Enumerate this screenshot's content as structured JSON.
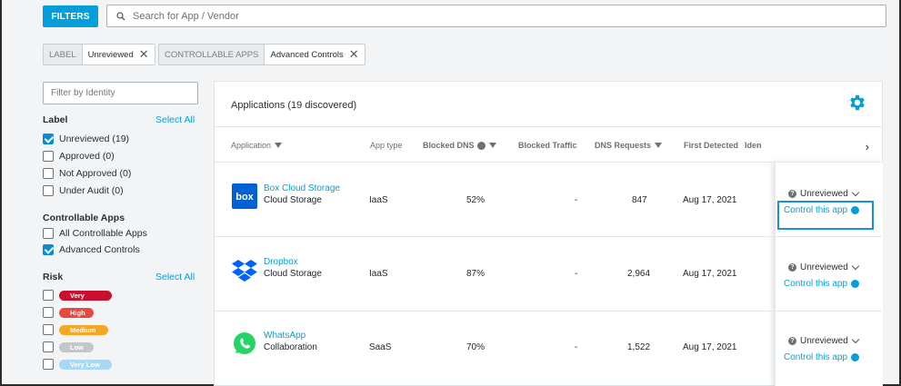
{
  "toolbar": {
    "filters_label": "FILTERS",
    "search_placeholder": "Search for App / Vendor"
  },
  "active_filters": [
    {
      "key": "LABEL",
      "value": "Unreviewed"
    },
    {
      "key": "CONTROLLABLE APPS",
      "value": "Advanced Controls"
    }
  ],
  "sidebar": {
    "identity_placeholder": "Filter by Identity",
    "label_section": {
      "title": "Label",
      "select_all": "Select All",
      "options": [
        {
          "label": "Unreviewed (19)",
          "checked": true
        },
        {
          "label": "Approved (0)",
          "checked": false
        },
        {
          "label": "Not Approved (0)",
          "checked": false
        },
        {
          "label": "Under Audit (0)",
          "checked": false
        }
      ]
    },
    "controllable_section": {
      "title": "Controllable Apps",
      "options": [
        {
          "label": "All Controllable Apps",
          "checked": false
        },
        {
          "label": "Advanced Controls",
          "checked": true
        }
      ]
    },
    "risk_section": {
      "title": "Risk",
      "select_all": "Select All",
      "options": [
        {
          "label": "Very High",
          "color": "#c8102e"
        },
        {
          "label": "High",
          "color": "#e8493f"
        },
        {
          "label": "Medium",
          "color": "#f5a623"
        },
        {
          "label": "Low",
          "color": "#c3c7ca"
        },
        {
          "label": "Very Low",
          "color": "#a9d8f5"
        }
      ]
    }
  },
  "main": {
    "title": "Applications (19 discovered)",
    "columns": {
      "application": "Application",
      "app_type": "App type",
      "blocked_dns": "Blocked DNS",
      "blocked_traffic": "Blocked Traffic",
      "dns_requests": "DNS Requests",
      "first_detected": "First Detected",
      "identity": "Iden"
    },
    "rows": [
      {
        "name": "Box Cloud Storage",
        "category": "Cloud Storage",
        "app_type": "IaaS",
        "blocked_dns": "52%",
        "blocked_traffic": "-",
        "dns_requests": "847",
        "first_detected": "Aug 17, 2021",
        "status": "Unreviewed",
        "action": "Control this app",
        "logo": "box-logo"
      },
      {
        "name": "Dropbox",
        "category": "Cloud Storage",
        "app_type": "IaaS",
        "blocked_dns": "87%",
        "blocked_traffic": "-",
        "dns_requests": "2,964",
        "first_detected": "Aug 17, 2021",
        "status": "Unreviewed",
        "action": "Control this app",
        "logo": "dropbox-logo"
      },
      {
        "name": "WhatsApp",
        "category": "Collaboration",
        "app_type": "SaaS",
        "blocked_dns": "70%",
        "blocked_traffic": "-",
        "dns_requests": "1,522",
        "first_detected": "Aug 17, 2021",
        "status": "Unreviewed",
        "action": "Control this app",
        "logo": "whatsapp-logo"
      }
    ]
  },
  "colors": {
    "accent": "#049fd9",
    "highlight_border": "#1a8fd6"
  }
}
